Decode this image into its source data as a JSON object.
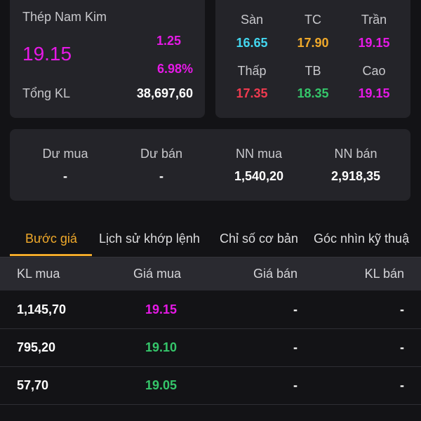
{
  "quote": {
    "name": "Thép Nam Kim",
    "price": "19.15",
    "change": "1.25",
    "change_pct": "6.98%",
    "volume_label": "Tổng KL",
    "volume_value": "38,697,60"
  },
  "levels": {
    "floor_label": "Sàn",
    "floor_value": "16.65",
    "ref_label": "TC",
    "ref_value": "17.90",
    "ceiling_label": "Trần",
    "ceiling_value": "19.15",
    "low_label": "Thấp",
    "low_value": "17.35",
    "avg_label": "TB",
    "avg_value": "18.35",
    "high_label": "Cao",
    "high_value": "19.15"
  },
  "surplus": {
    "buy_label": "Dư mua",
    "buy_value": "-",
    "sell_label": "Dư bán",
    "sell_value": "-",
    "foreign_buy_label": "NN mua",
    "foreign_buy_value": "1,540,20",
    "foreign_sell_label": "NN bán",
    "foreign_sell_value": "2,918,35"
  },
  "tabs": [
    {
      "label": "Bước giá",
      "active": true
    },
    {
      "label": "Lịch sử khớp lệnh",
      "active": false
    },
    {
      "label": "Chỉ số cơ bản",
      "active": false
    },
    {
      "label": "Góc nhìn kỹ thuậ",
      "active": false
    }
  ],
  "table": {
    "headers": [
      "KL mua",
      "Giá mua",
      "Giá bán",
      "KL bán"
    ],
    "rows": [
      {
        "buy_vol": "1,145,70",
        "buy_price": "19.15",
        "sell_price": "-",
        "sell_vol": "-"
      },
      {
        "buy_vol": "795,20",
        "buy_price": "19.10",
        "sell_price": "-",
        "sell_vol": "-"
      },
      {
        "buy_vol": "57,70",
        "buy_price": "19.05",
        "sell_price": "-",
        "sell_vol": "-"
      }
    ]
  },
  "colors": {
    "background": "#131316",
    "card": "#242429",
    "ceiling": "#e619e6",
    "floor": "#43d6ef",
    "reference": "#f0a92a",
    "down": "#ef3a4f",
    "up": "#35c66a",
    "active_tab": "#f0a92a"
  }
}
